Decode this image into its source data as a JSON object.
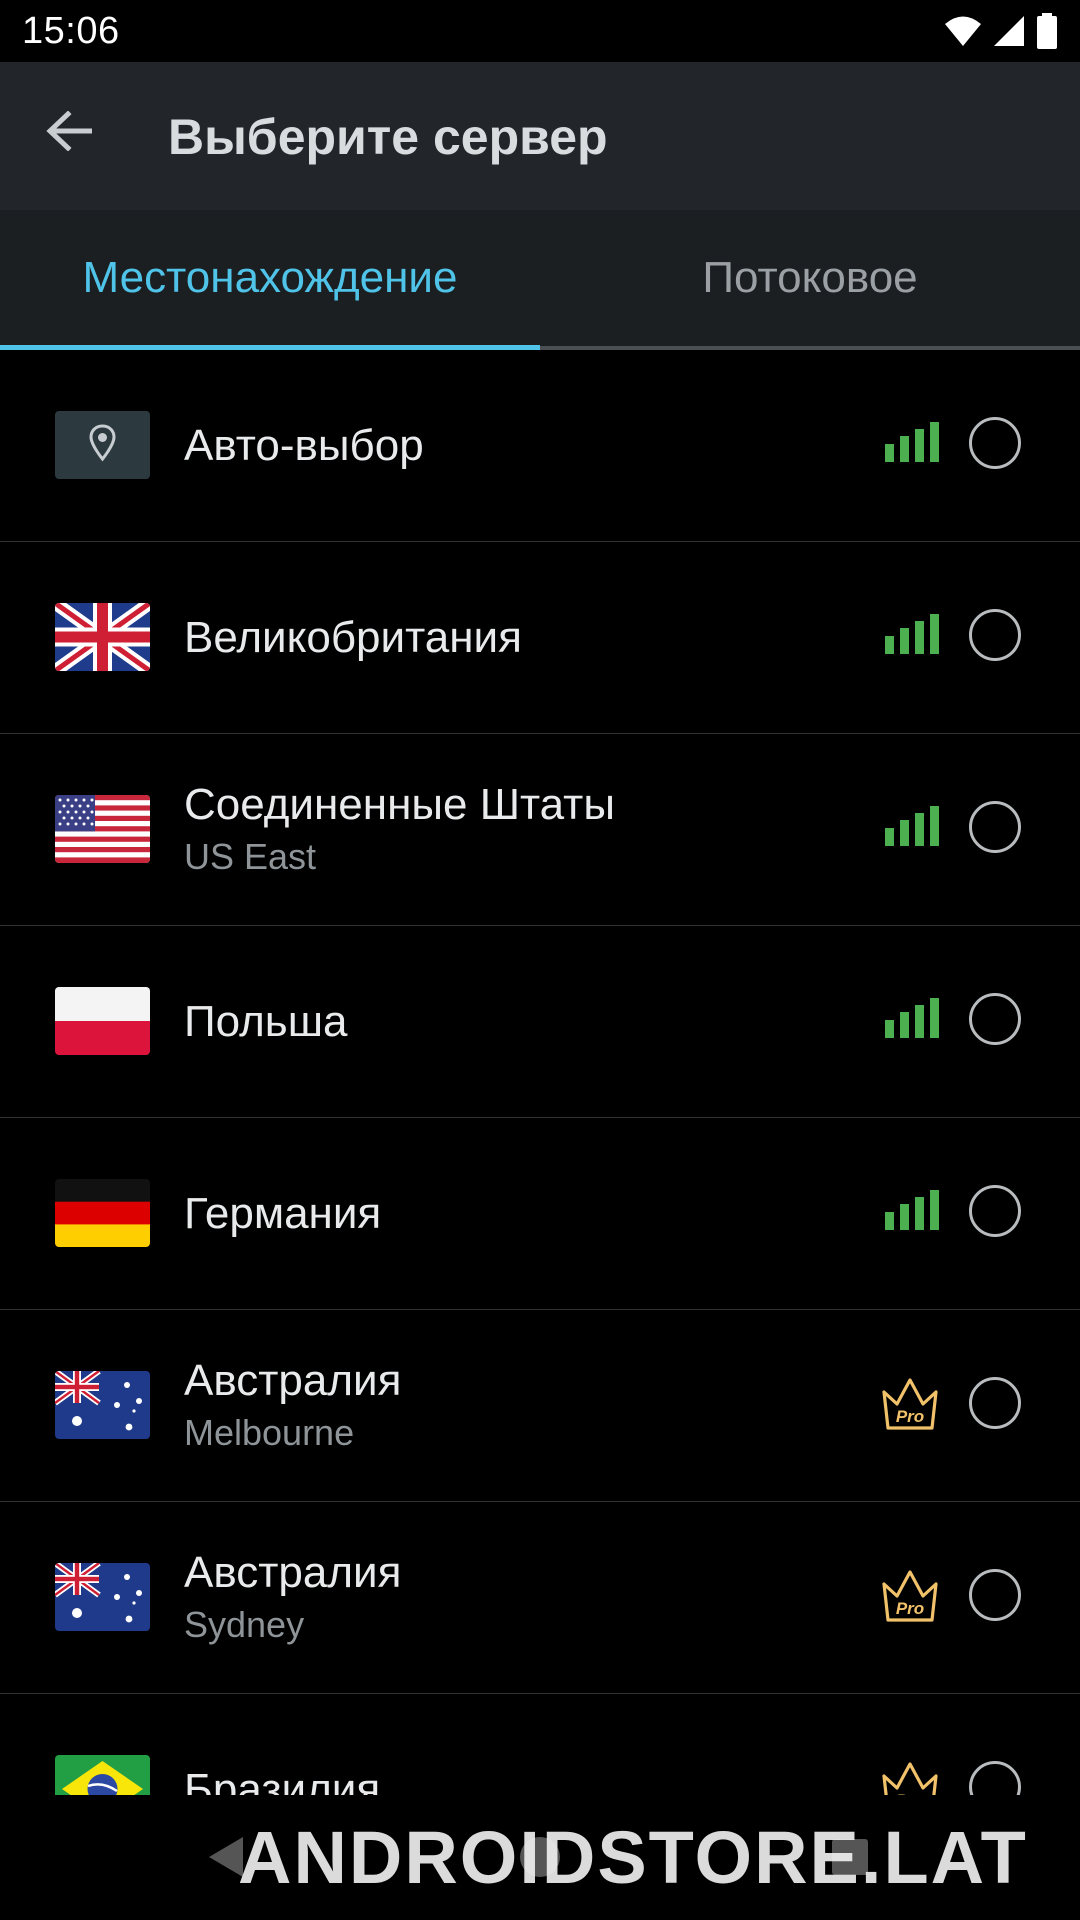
{
  "status_bar": {
    "time": "15:06"
  },
  "header": {
    "title": "Выберите сервер"
  },
  "tabs": [
    {
      "label": "Местонахождение",
      "active": true
    },
    {
      "label": "Потоковое",
      "active": false
    }
  ],
  "servers": [
    {
      "title": "Авто-выбор",
      "subtitle": "",
      "icon": "location-pin-icon",
      "indicator": "signal",
      "selected": false
    },
    {
      "title": "Великобритания",
      "subtitle": "",
      "icon": "uk-flag-icon",
      "indicator": "signal",
      "selected": false
    },
    {
      "title": "Соединенные Штаты",
      "subtitle": "US East",
      "icon": "us-flag-icon",
      "indicator": "signal",
      "selected": false
    },
    {
      "title": "Польша",
      "subtitle": "",
      "icon": "poland-flag-icon",
      "indicator": "signal",
      "selected": false
    },
    {
      "title": "Германия",
      "subtitle": "",
      "icon": "germany-flag-icon",
      "indicator": "signal",
      "selected": false
    },
    {
      "title": "Австралия",
      "subtitle": "Melbourne",
      "icon": "australia-flag-icon",
      "indicator": "pro",
      "selected": false
    },
    {
      "title": "Австралия",
      "subtitle": "Sydney",
      "icon": "australia-flag-icon",
      "indicator": "pro",
      "selected": false
    },
    {
      "title": "Бразилия",
      "subtitle": "",
      "icon": "brazil-flag-icon",
      "indicator": "pro",
      "selected": false
    }
  ],
  "pro_badge_label": "Pro",
  "watermark": "ANDROIDSTORE.LAT",
  "colors": {
    "accent": "#4fc3e8",
    "signal_green": "#4caf50",
    "pro_gold": "#f2c26b",
    "app_bar": "#22262a",
    "tab_bar": "#1b1f22"
  }
}
